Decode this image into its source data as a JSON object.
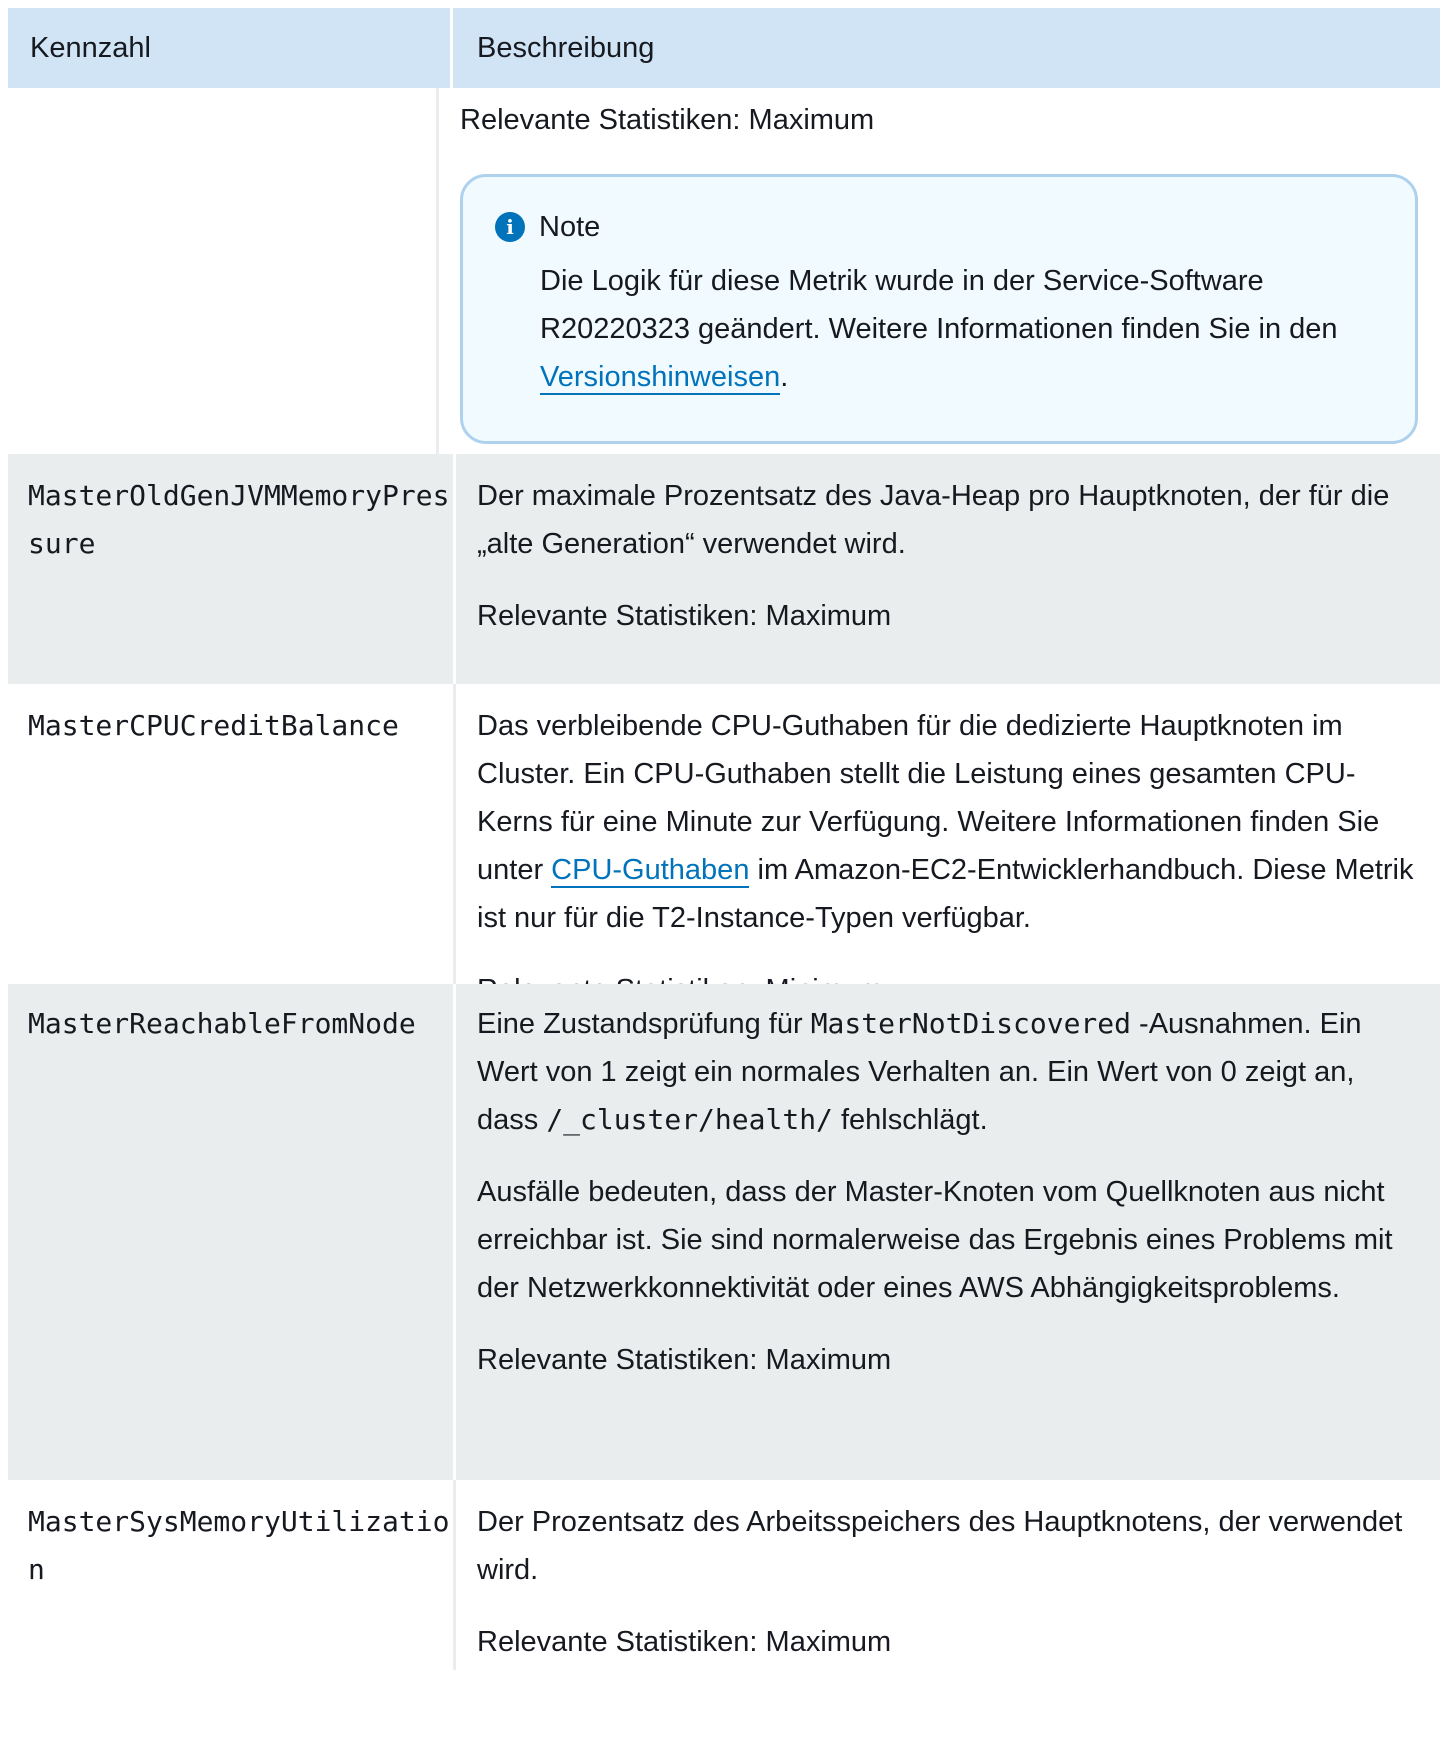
{
  "header": {
    "col1": "Kennzahl",
    "col2": "Beschreibung"
  },
  "first_row": {
    "stat": "Relevante Statistiken: Maximum",
    "note": {
      "icon": "info-icon",
      "title": "Note",
      "text_before": "Die Logik für diese Metrik wurde in der Service-Software R20220323 geändert. Weitere Informationen finden Sie in den ",
      "link": "Versionshinweisen",
      "text_after": "."
    }
  },
  "rows": [
    {
      "name": "MasterOldGenJVMMemoryPressure",
      "desc": "Der maximale Prozentsatz des Java-Heap pro Hauptknoten, der für die „alte Generation“ verwendet wird.",
      "stat": "Relevante Statistiken: Maximum"
    },
    {
      "name": "MasterCPUCreditBalance",
      "desc_before": "Das verbleibende CPU-Guthaben für die dedizierte Hauptknoten im Cluster. Ein CPU-Guthaben stellt die Leistung eines gesamten CPU-Kerns für eine Minute zur Verfügung. Weitere Informationen finden Sie unter ",
      "link": "CPU-Guthaben",
      "desc_after": " im Amazon-EC2-Entwicklerhandbuch. Diese Metrik ist nur für die T2-Instance-Typen verfügbar.",
      "stat": "Relevante Statistiken: Minimum"
    },
    {
      "name": "MasterReachableFromNode",
      "desc_1": "Eine Zustandsprüfung für ",
      "code_1": "MasterNotDiscovered",
      "desc_2": " -Ausnahmen. Ein Wert von 1 zeigt ein normales Verhalten an. Ein Wert von 0 zeigt an, dass ",
      "code_2": "/_cluster/health/",
      "desc_3": " fehlschlägt.",
      "desc_para2": "Ausfälle bedeuten, dass der Master-Knoten vom Quellknoten aus nicht erreichbar ist. Sie sind normalerweise das Ergebnis eines Problems mit der Netzwerkkonnektivität oder eines AWS Abhängigkeitsproblems.",
      "stat": "Relevante Statistiken: Maximum"
    },
    {
      "name": "MasterSysMemoryUtilization",
      "desc": "Der Prozentsatz des Arbeitsspeichers des Hauptknotens, der verwendet wird.",
      "stat": "Relevante Statistiken: Maximum"
    }
  ]
}
